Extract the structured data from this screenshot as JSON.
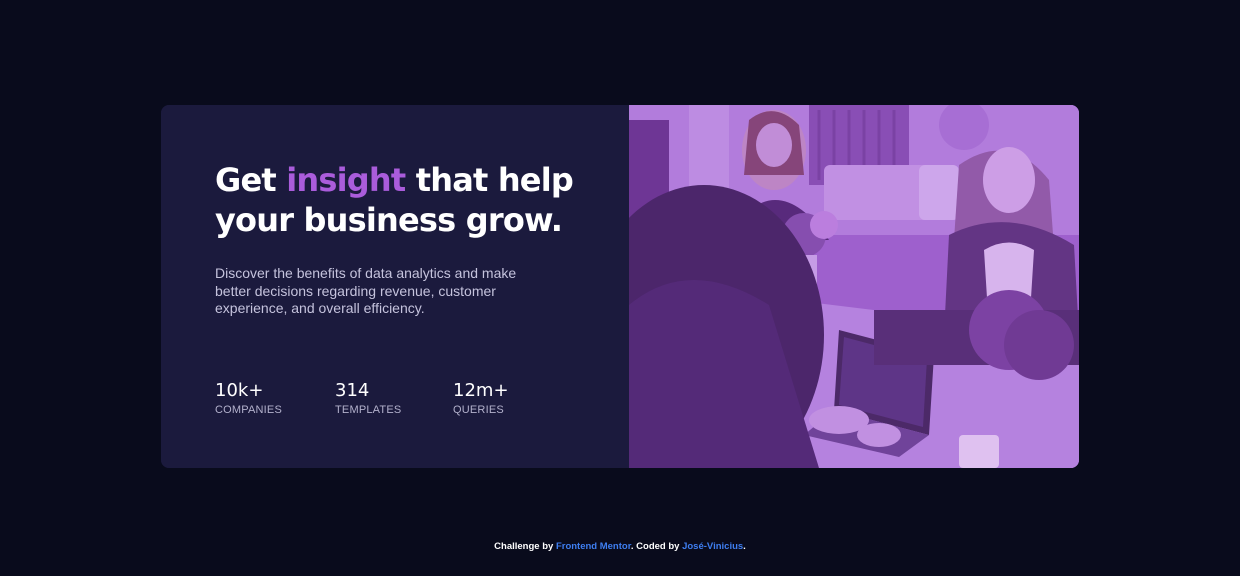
{
  "hero": {
    "headline_before": "Get ",
    "headline_accent": "insight",
    "headline_after": " that help your business grow.",
    "description": "Discover the benefits of data analytics and make better decisions regarding revenue, customer experience, and overall efficiency."
  },
  "stats": [
    {
      "value": "10k+",
      "label": "companies"
    },
    {
      "value": "314",
      "label": "templates"
    },
    {
      "value": "12m+",
      "label": "queries"
    }
  ],
  "image": {
    "subject": "people working at a table with laptops in an office",
    "tint_color": "#aa5cdb"
  },
  "footer": {
    "prefix": "Challenge by ",
    "challenge_link": "Frontend Mentor",
    "middle": ". Coded by ",
    "author_link": "José-Vinicius",
    "suffix": "."
  },
  "colors": {
    "background": "#090b1c",
    "card": "#1b1a3d",
    "accent": "#aa5cdb",
    "link": "#3e7ef0"
  }
}
